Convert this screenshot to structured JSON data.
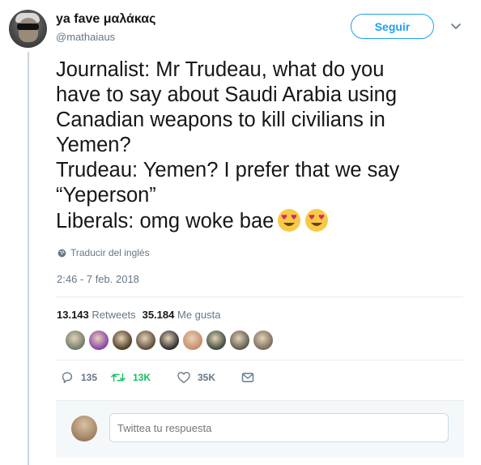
{
  "author": {
    "name": "ya fave μαλάκας",
    "handle": "@mathaiaus"
  },
  "follow_button": "Seguir",
  "tweet": {
    "lines": [
      "Journalist: Mr Trudeau, what do you",
      "have to say about Saudi Arabia using",
      "Canadian weapons to kill civilians in",
      "Yemen?",
      "Trudeau: Yemen? I prefer that we say",
      "“Yeperson”",
      "Liberals: omg woke bae"
    ],
    "emoji": [
      "heart-eyes-emoji",
      "heart-eyes-emoji"
    ]
  },
  "translate_label": "Traducir del inglés",
  "timestamp": "2:46 - 7 feb. 2018",
  "stats": {
    "retweets_count": "13.143",
    "retweets_label": "Retweets",
    "likes_count": "35.184",
    "likes_label": "Me gusta"
  },
  "likers": [
    "#6d7a6a",
    "#8a3fa8",
    "#4a3a20",
    "#5a4a3a",
    "#2a2a2a",
    "#c98a6a",
    "#3a4a3a",
    "#5a5a4a",
    "#7a6a5a"
  ],
  "actions": {
    "reply_count": "135",
    "retweet_count": "13K",
    "like_count": "35K"
  },
  "reply": {
    "placeholder": "Twittea tu respuesta"
  },
  "colors": {
    "accent": "#1da1f2",
    "retweet_active": "#17bf63",
    "muted": "#657786"
  }
}
